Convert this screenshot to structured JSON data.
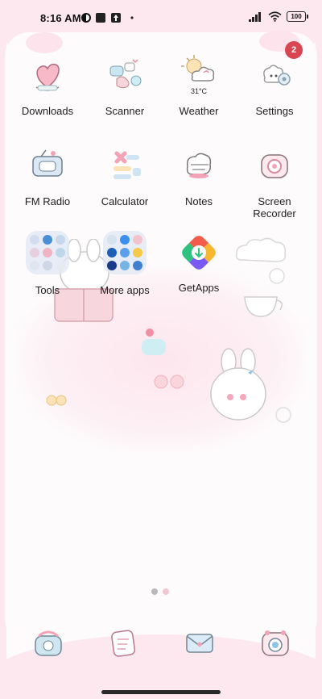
{
  "status_bar": {
    "time": "8:16 AM",
    "battery": "100",
    "icons": [
      "app-notification-icon",
      "square-notification-icon",
      "upload-notification-icon",
      "more-dot-icon",
      "signal-icon",
      "wifi-icon",
      "battery-icon"
    ]
  },
  "apps": [
    {
      "label": "Downloads",
      "icon": "downloads-icon"
    },
    {
      "label": "Scanner",
      "icon": "scanner-icon"
    },
    {
      "label": "Weather",
      "icon": "weather-icon",
      "temperature": "31°C"
    },
    {
      "label": "Settings",
      "icon": "settings-icon",
      "badge": "2"
    },
    {
      "label": "FM Radio",
      "icon": "fm-radio-icon"
    },
    {
      "label": "Calculator",
      "icon": "calculator-icon"
    },
    {
      "label": "Notes",
      "icon": "notes-icon"
    },
    {
      "label": "Screen\nRecorder",
      "icon": "screen-recorder-icon"
    },
    {
      "label": "Tools",
      "icon": "tools-folder-icon"
    },
    {
      "label": "More apps",
      "icon": "more-apps-folder-icon"
    },
    {
      "label": "GetApps",
      "icon": "getapps-icon"
    }
  ],
  "page_indicator": {
    "pages": 2,
    "current": 1
  },
  "dock": [
    "phone-icon",
    "messages-icon",
    "email-icon",
    "camera-icon"
  ],
  "colors": {
    "accent_pink": "#f7c6d4",
    "badge": "#d94550",
    "dot_active": "#b8b8bc",
    "dot_inactive": "#f3c4d1"
  }
}
